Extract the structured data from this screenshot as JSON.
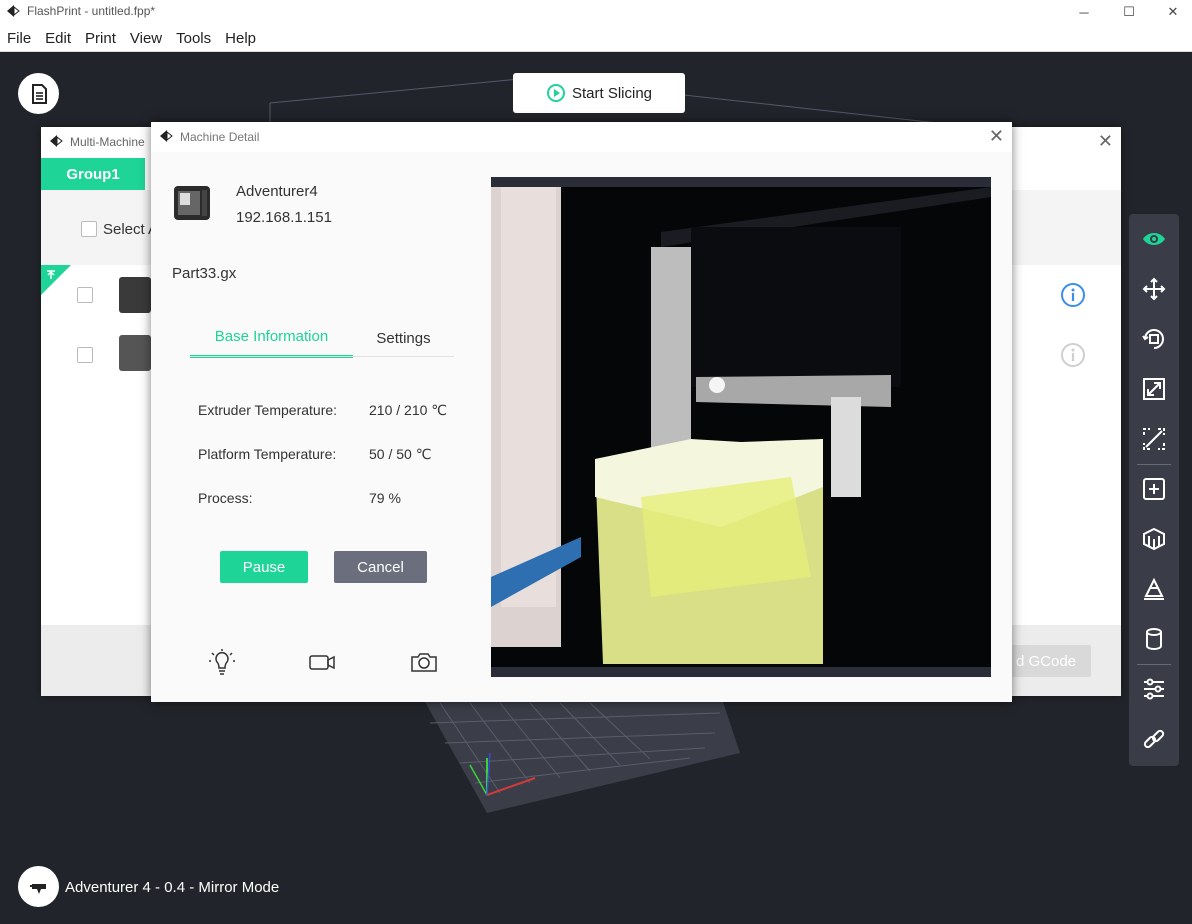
{
  "window": {
    "title": "FlashPrint - untitled.fpp*"
  },
  "menu": [
    "File",
    "Edit",
    "Print",
    "View",
    "Tools",
    "Help"
  ],
  "toolbar": {
    "start_slicing": "Start Slicing"
  },
  "status": {
    "printer_mode": "Adventurer 4 - 0.4 - Mirror Mode"
  },
  "right_tools": [
    "view-icon",
    "move-icon",
    "rotate-icon",
    "scale-icon",
    "cut-icon",
    "add-icon",
    "support-icon",
    "on-platform-icon",
    "material-icon",
    "settings-icon",
    "link-icon"
  ],
  "multi_machine": {
    "title": "Multi-Machine",
    "group_tab": "Group1",
    "select_all": "Select A",
    "gcode_button": "d GCode"
  },
  "machine_detail": {
    "title": "Machine Detail",
    "machine_name": "Adventurer4",
    "ip": "192.168.1.151",
    "part": "Part33.gx",
    "tabs": {
      "base": "Base Information",
      "settings": "Settings"
    },
    "info": [
      {
        "label": "Extruder Temperature:",
        "value": "210 / 210 ℃"
      },
      {
        "label": "Platform Temperature:",
        "value": "50 / 50 ℃"
      },
      {
        "label": "Process:",
        "value": "79 %"
      }
    ],
    "buttons": {
      "pause": "Pause",
      "cancel": "Cancel"
    }
  },
  "colors": {
    "accent": "#1ed497",
    "info_blue": "#3a8ee6",
    "toolbar_bg": "#3a3d47",
    "cancel_bg": "#6b6e7c"
  }
}
